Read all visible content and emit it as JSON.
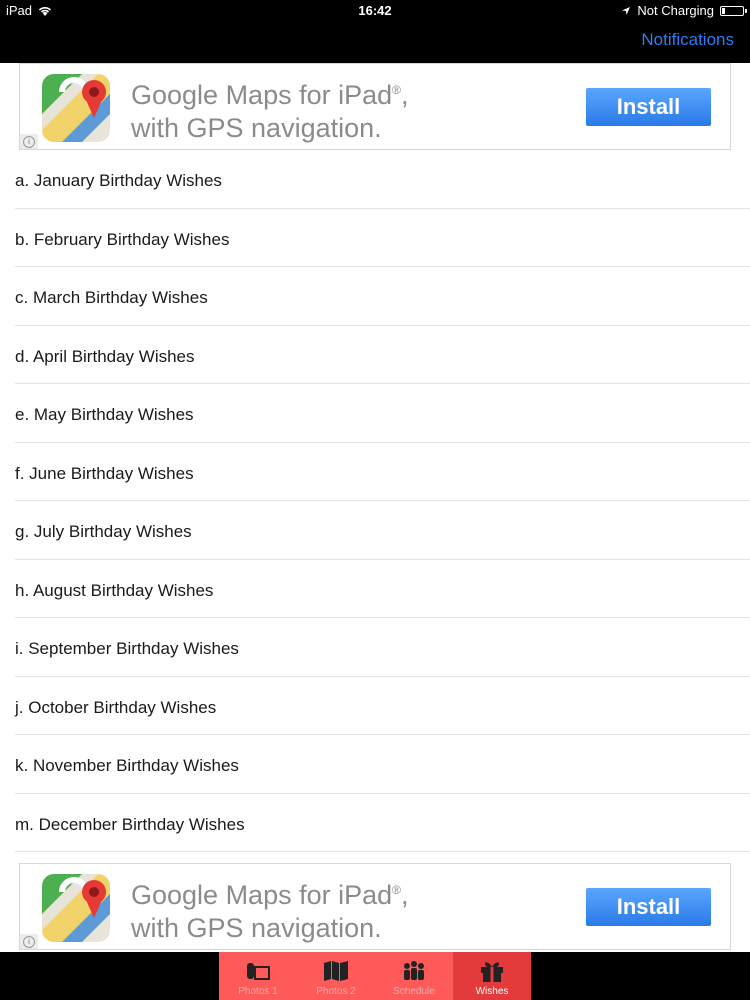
{
  "status_bar": {
    "device": "iPad",
    "time": "16:42",
    "charging": "Not Charging"
  },
  "nav": {
    "right_button": "Notifications"
  },
  "ads": [
    {
      "line1": "Google Maps for iPad",
      "line2": "with GPS navigation.",
      "button": "Install",
      "icon": "maps-icon"
    },
    {
      "line1": "Google Maps for iPad",
      "line2": "with GPS navigation.",
      "button": "Install",
      "icon": "maps-icon"
    }
  ],
  "list": {
    "items": [
      "a. January Birthday Wishes",
      "b. February Birthday Wishes",
      "c. March Birthday Wishes",
      "d. April Birthday Wishes",
      "e. May Birthday Wishes",
      "f. June Birthday Wishes",
      "g. July Birthday Wishes",
      "h. August Birthday Wishes",
      "i. September Birthday Wishes",
      "j. October Birthday Wishes",
      "k. November Birthday Wishes",
      "m. December Birthday Wishes"
    ]
  },
  "tabbar": {
    "tabs": [
      {
        "label": "Photos 1",
        "icon": "photos-icon",
        "active": false
      },
      {
        "label": "Photos 2",
        "icon": "map-icon",
        "active": false
      },
      {
        "label": "Schedule",
        "icon": "people-icon",
        "active": false
      },
      {
        "label": "Wishes",
        "icon": "gift-icon",
        "active": true
      }
    ]
  },
  "colors": {
    "nav_button": "#2d7cf3",
    "tab_bg": "#ff5a5a",
    "tab_active_bg": "#e33b3b",
    "install_button": "#2a7ae8"
  }
}
